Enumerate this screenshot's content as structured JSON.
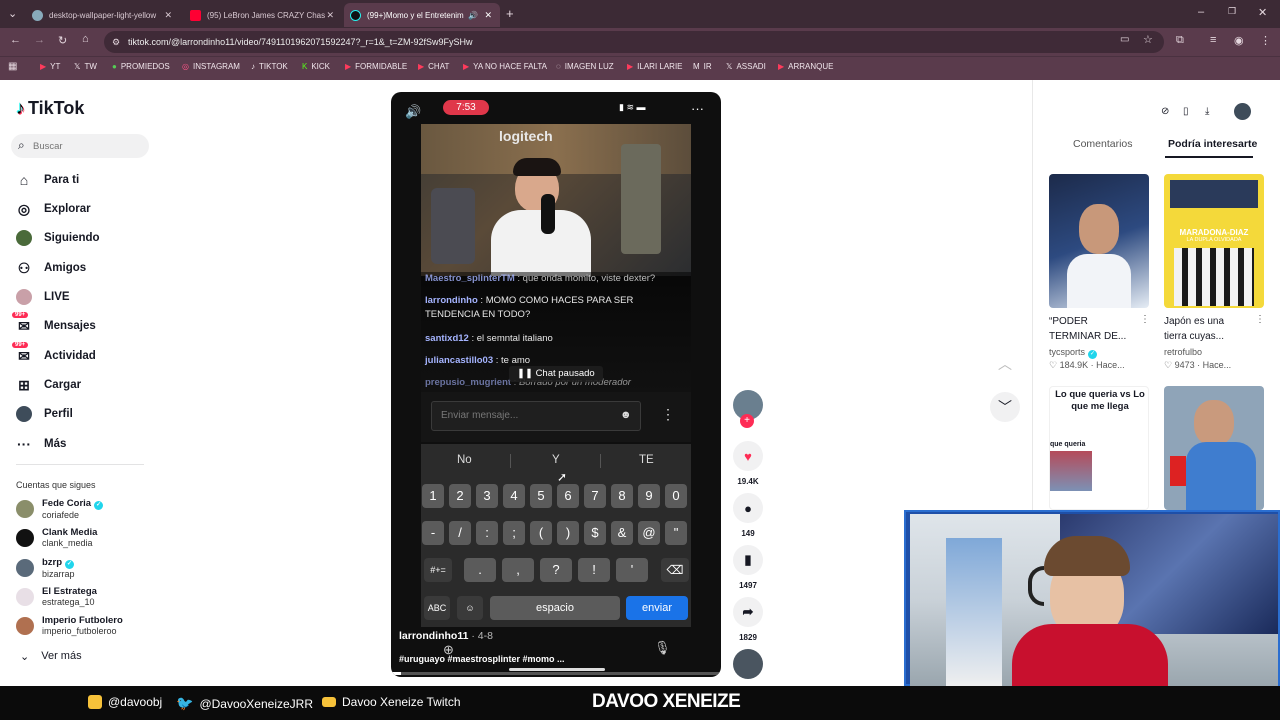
{
  "browser": {
    "tabs": [
      {
        "title": "desktop-wallpaper-light-yellow",
        "icon": "globe-icon",
        "active": false
      },
      {
        "title": "(95) LeBron James CRAZY Chas",
        "icon": "youtube-icon",
        "active": false
      },
      {
        "title": "(99+)Momo y el Entretenim",
        "icon": "tiktok-icon",
        "active": true
      }
    ],
    "url": "tiktok.com/@larrondinho11/video/7491101962071592247?_r=1&_t=ZM-92fSw9FySHw",
    "bookmarks": [
      "YT",
      "TW",
      "PROMIEDOS",
      "INSTAGRAM",
      "TIKTOK",
      "KICK",
      "FORMIDABLE",
      "CHAT",
      "YA NO HACE FALTA",
      "IMAGEN LUZ",
      "ILARI LARIE",
      "IR",
      "ASSADI",
      "ARRANQUE"
    ]
  },
  "sidebar": {
    "logo": "TikTok",
    "search_placeholder": "Buscar",
    "nav": [
      {
        "label": "Para ti",
        "icon": "home-icon"
      },
      {
        "label": "Explorar",
        "icon": "compass-icon"
      },
      {
        "label": "Siguiendo",
        "icon": "following-icon"
      },
      {
        "label": "Amigos",
        "icon": "friends-icon"
      },
      {
        "label": "LIVE",
        "icon": "live-icon"
      },
      {
        "label": "Mensajes",
        "icon": "messages-icon",
        "badge": "99+"
      },
      {
        "label": "Actividad",
        "icon": "activity-icon",
        "badge": "99+"
      },
      {
        "label": "Cargar",
        "icon": "upload-icon"
      },
      {
        "label": "Perfil",
        "icon": "profile-icon"
      },
      {
        "label": "Más",
        "icon": "more-icon"
      }
    ],
    "following_title": "Cuentas que sigues",
    "accounts": [
      {
        "name": "Fede Coria",
        "handle": "coriafede",
        "verified": true
      },
      {
        "name": "Clank Media",
        "handle": "clank_media",
        "verified": false
      },
      {
        "name": "bzrp",
        "handle": "bizarrap",
        "verified": true
      },
      {
        "name": "El Estratega",
        "handle": "estratega_10",
        "verified": false
      },
      {
        "name": "Imperio Futbolero",
        "handle": "imperio_futboleroo",
        "verified": false
      }
    ],
    "see_more": "Ver más"
  },
  "phone": {
    "time": "7:53",
    "video_sign": "logitech",
    "chat": [
      {
        "user": "Maestro_splinterTM",
        "text": "que onda momito, viste dexter?"
      },
      {
        "user": "larrondinho",
        "text": "MOMO COMO HACES PARA SER TENDENCIA EN TODO?"
      },
      {
        "user": "santixd12",
        "text": "el semntal italiano"
      },
      {
        "user": "juliancastillo03",
        "text": "te amo"
      },
      {
        "user": "prepusio_mugrient",
        "text": "Borrado por un moderador"
      }
    ],
    "chat_paused": "Chat pausado",
    "message_placeholder": "Enviar mensaje...",
    "suggestions": [
      "No",
      "Y",
      "TE"
    ],
    "keys_row1": [
      "1",
      "2",
      "3",
      "4",
      "5",
      "6",
      "7",
      "8",
      "9",
      "0"
    ],
    "keys_row2": [
      "-",
      "/",
      ":",
      ";",
      "(",
      ")",
      "$",
      "&",
      "@",
      "\""
    ],
    "keys_row3": [
      "#+=",
      ".",
      ",",
      "?",
      "!",
      "'"
    ],
    "abc": "ABC",
    "space": "espacio",
    "send": "enviar",
    "author": "larrondinho11",
    "date": "4-8",
    "caption": "#uruguayo #maestrosplinter #momo ..."
  },
  "actions": {
    "likes": "19.4K",
    "comments": "149",
    "saves": "1497",
    "shares": "1829"
  },
  "panel": {
    "tabs": [
      "Comentarios",
      "Podría interesarte"
    ],
    "cards": [
      {
        "title": "“PODER TERMINAR DE...",
        "user": "tycsports",
        "verified": true,
        "stat": "184.9K",
        "time": "Hace..."
      },
      {
        "title": "Japón es una tierra cuyas...",
        "user": "retrofulbo",
        "verified": false,
        "stat": "9473",
        "time": "Hace..."
      }
    ],
    "card3_text": "Lo que queria vs Lo que me llega",
    "card3_sub": "que queria",
    "card2_banner": "MARADONA-DIAZ",
    "card2_sub": "LA DUPLA OLVIDADA"
  },
  "overlay": {
    "instagram": "@davoobj",
    "twitter": "@DavooXeneizeJRR",
    "twitch": "Davoo Xeneize Twitch",
    "brand": "DAVOO XENEIZE"
  }
}
